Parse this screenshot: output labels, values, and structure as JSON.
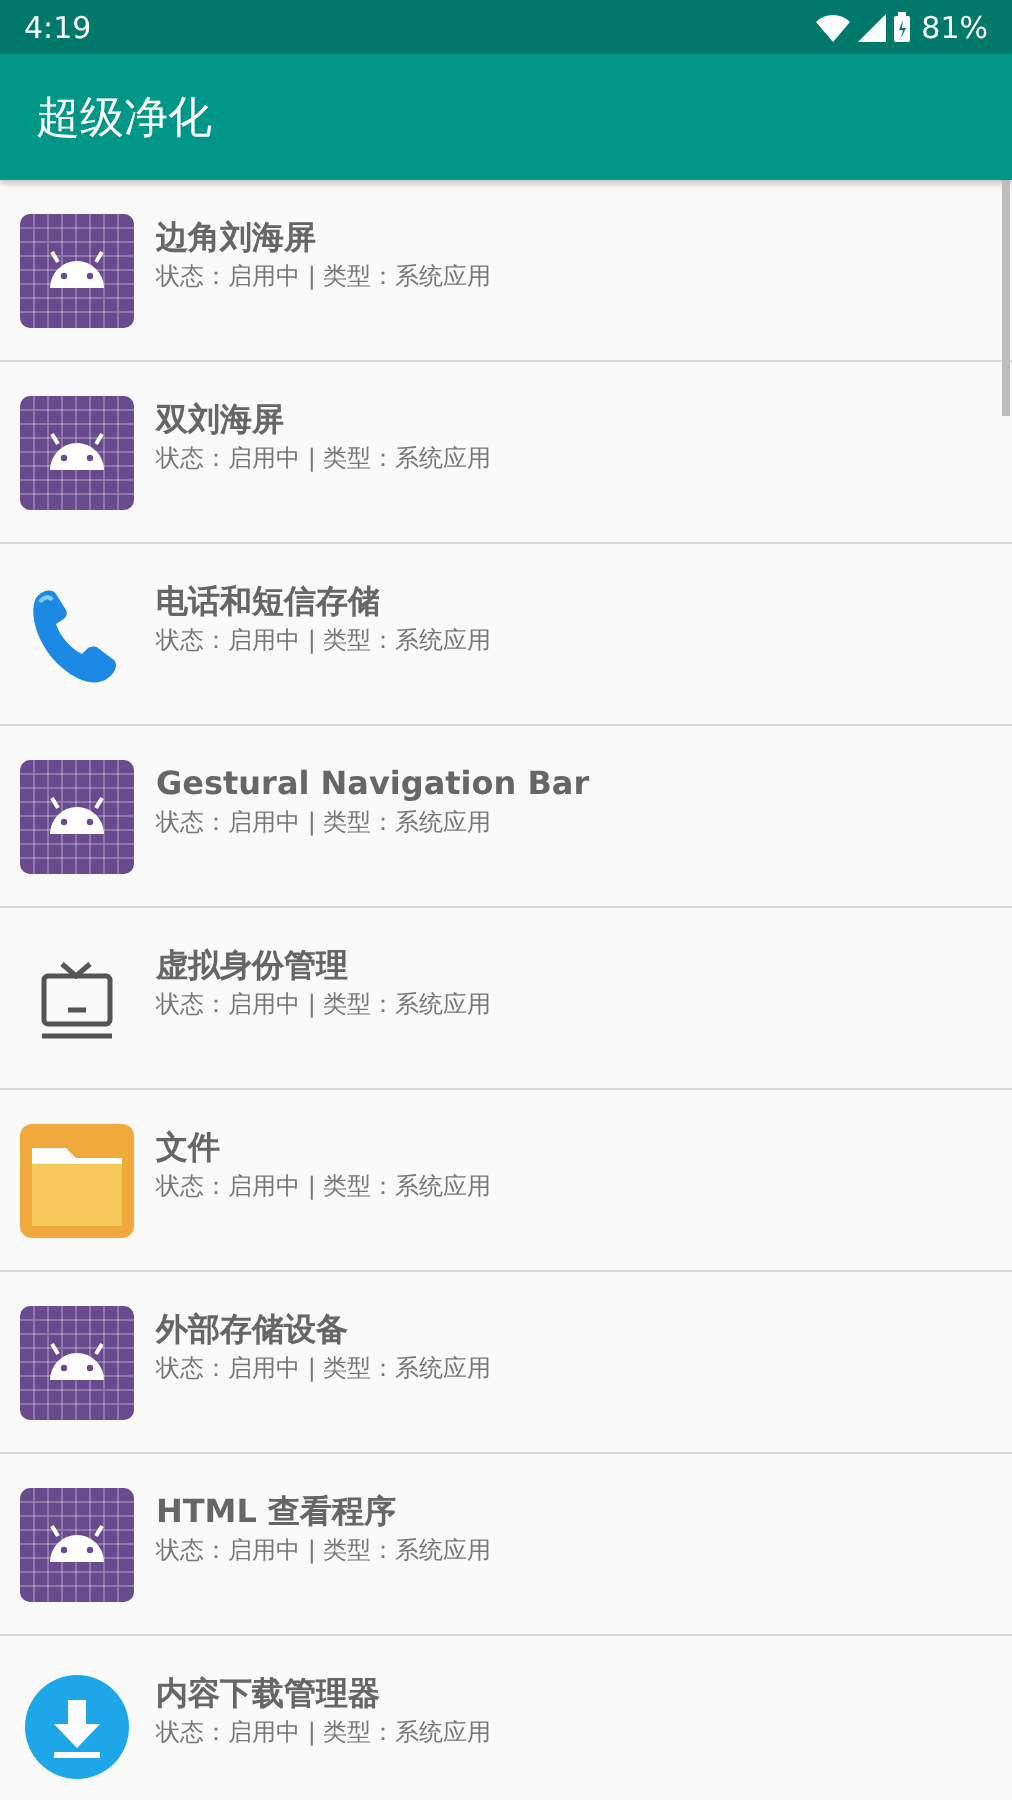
{
  "status_bar": {
    "time": "4:19",
    "battery": "81%"
  },
  "app_bar": {
    "title": "超级净化"
  },
  "apps": [
    {
      "name": "边角刘海屏",
      "detail": "状态：启用中 | 类型：系统应用",
      "kind": "android"
    },
    {
      "name": "双刘海屏",
      "detail": "状态：启用中 | 类型：系统应用",
      "kind": "android"
    },
    {
      "name": "电话和短信存储",
      "detail": "状态：启用中 | 类型：系统应用",
      "kind": "phone"
    },
    {
      "name": "Gestural Navigation Bar",
      "detail": "状态：启用中 | 类型：系统应用",
      "kind": "android"
    },
    {
      "name": "虚拟身份管理",
      "detail": "状态：启用中 | 类型：系统应用",
      "kind": "tv"
    },
    {
      "name": "文件",
      "detail": "状态：启用中 | 类型：系统应用",
      "kind": "folder"
    },
    {
      "name": "外部存储设备",
      "detail": "状态：启用中 | 类型：系统应用",
      "kind": "android"
    },
    {
      "name": "HTML 查看程序",
      "detail": "状态：启用中 | 类型：系统应用",
      "kind": "android"
    },
    {
      "name": "内容下载管理器",
      "detail": "状态：启用中 | 类型：系统应用",
      "kind": "download"
    }
  ]
}
